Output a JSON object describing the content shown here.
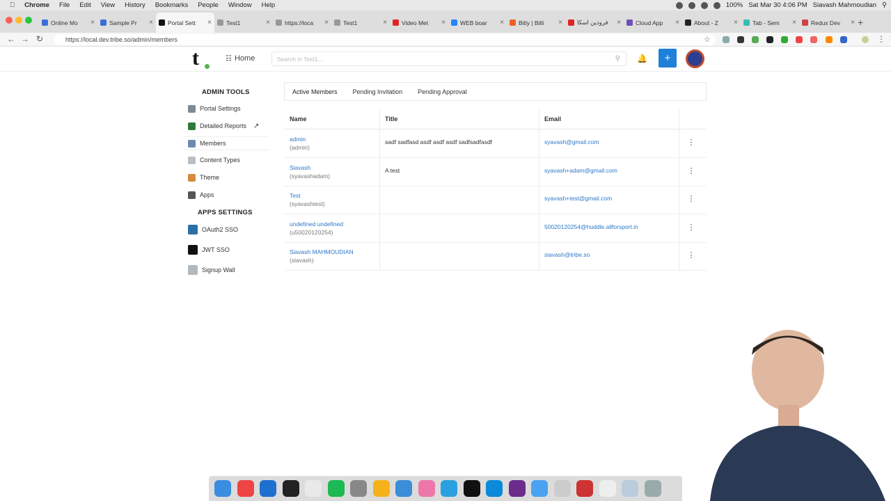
{
  "macbar": {
    "menus": [
      "Chrome",
      "File",
      "Edit",
      "View",
      "History",
      "Bookmarks",
      "People",
      "Window",
      "Help"
    ],
    "battery": "100%",
    "clock": "Sat Mar 30  4:06 PM",
    "user": "Siavash Mahmoudian"
  },
  "tabs": [
    {
      "label": "Online Mo",
      "color": "#3a6fd8"
    },
    {
      "label": "Sample Pr",
      "color": "#3a6fd8"
    },
    {
      "label": "Portal Sett",
      "color": "#111"
    },
    {
      "label": "Test1",
      "color": "#999"
    },
    {
      "label": "https://loca",
      "color": "#999"
    },
    {
      "label": "Test1",
      "color": "#999"
    },
    {
      "label": "Video Met",
      "color": "#e02424"
    },
    {
      "label": "WEB boar",
      "color": "#2684ff"
    },
    {
      "label": "Bitly | Billi",
      "color": "#ee6123"
    },
    {
      "label": "ﻓﺮﻭﺩﻳﻦ ﺍﺳﻜﺎ",
      "color": "#e02424"
    },
    {
      "label": "Cloud App",
      "color": "#6f4fb3"
    },
    {
      "label": "About - Z",
      "color": "#222"
    },
    {
      "label": "Tab - Sem",
      "color": "#35bdb2"
    },
    {
      "label": "Redux Dev",
      "color": "#c44"
    }
  ],
  "address": {
    "url": "https://local.dev.tribe.so/admin/members"
  },
  "header": {
    "logo": "t.",
    "home": "Home",
    "search_placeholder": "Search in Test1..."
  },
  "sidebar": {
    "admin_heading": "ADMIN TOOLS",
    "admin_items": [
      {
        "label": "Portal Settings",
        "icon": "gear-icon",
        "color": "#7d8a96"
      },
      {
        "label": "Detailed Reports",
        "icon": "chart-icon",
        "color": "#2d7a3a"
      },
      {
        "label": "Members",
        "icon": "users-icon",
        "color": "#6c8ab0"
      },
      {
        "label": "Content Types",
        "icon": "document-icon",
        "color": "#b7c0c8"
      },
      {
        "label": "Theme",
        "icon": "palette-icon",
        "color": "#d8893b"
      },
      {
        "label": "Apps",
        "icon": "phone-icon",
        "color": "#555"
      }
    ],
    "apps_heading": "APPS SETTINGS",
    "app_items": [
      {
        "label": "OAuth2 SSO",
        "icon": "oauth-icon",
        "color": "#2b6fa6"
      },
      {
        "label": "JWT SSO",
        "icon": "jwt-icon",
        "color": "#111"
      },
      {
        "label": "Signup Wall",
        "icon": "wall-icon",
        "color": "#b0b8c0"
      }
    ]
  },
  "member_tabs": [
    "Active Members",
    "Pending Invitation",
    "Pending Approval"
  ],
  "table": {
    "columns": [
      "Name",
      "Title",
      "Email"
    ],
    "rows": [
      {
        "name": "admin",
        "username": "(admin)",
        "title": "sadf sadfasd asdf asdf asdf sadfsadfasdf",
        "email": "syavash@gmail.com"
      },
      {
        "name": "Siavash",
        "username": "(syavashadam)",
        "title": "A test",
        "email": "syavash+adam@gmail.com"
      },
      {
        "name": "Test",
        "username": "(syavashtest)",
        "title": "",
        "email": "syavash+test@gmail.com"
      },
      {
        "name": "undefined undefined",
        "username": "(u50020120254)",
        "title": "",
        "email": "50020120254@huddle.allforsport.in"
      },
      {
        "name": "Siavash MAHMOUDIAN",
        "username": "(siavash)",
        "title": "",
        "email": "siavash@tribe.so"
      }
    ]
  }
}
